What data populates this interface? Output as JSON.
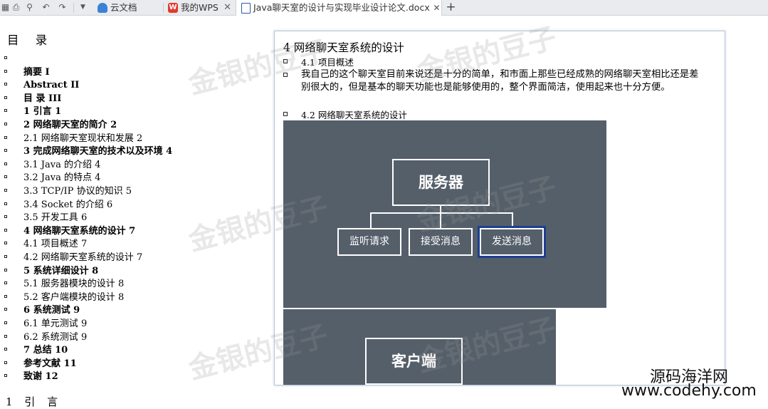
{
  "tabs": [
    {
      "label": "云文档",
      "icon": "cloud-doc-icon",
      "color": "#3b82d6"
    },
    {
      "label": "我的WPS",
      "icon": "wps-logo-icon",
      "color": "#e23a2e"
    },
    {
      "label": "Java聊天室的设计与实现毕业设计论文.docx",
      "icon": "word-doc-icon",
      "color": "#2c5aa0",
      "active": true
    }
  ],
  "toc": {
    "title": "目 录",
    "items": [
      {
        "text": "",
        "bold": false
      },
      {
        "text": "摘要    I",
        "bold": true
      },
      {
        "text": "Abstract    II",
        "bold": true
      },
      {
        "text": "目  录    III",
        "bold": true
      },
      {
        "text": "1 引言    1",
        "bold": true
      },
      {
        "text": "2 网络聊天室的简介    2",
        "bold": true
      },
      {
        "text": "2.1 网络聊天室现状和发展    2",
        "bold": false
      },
      {
        "text": "3 完成网络聊天室的技术以及环境    4",
        "bold": true
      },
      {
        "text": "3.1 Java 的介绍    4",
        "bold": false
      },
      {
        "text": "3.2 Java 的特点    4",
        "bold": false
      },
      {
        "text": "3.3 TCP/IP 协议的知识    5",
        "bold": false
      },
      {
        "text": "3.4 Socket 的介绍    6",
        "bold": false
      },
      {
        "text": "3.5 开发工具    6",
        "bold": false
      },
      {
        "text": "4 网络聊天室系统的设计    7",
        "bold": true
      },
      {
        "text": "4.1 项目概述    7",
        "bold": false
      },
      {
        "text": "4.2 网络聊天室系统的设计    7",
        "bold": false
      },
      {
        "text": "5 系统详细设计    8",
        "bold": true
      },
      {
        "text": "5.1 服务器模块的设计    8",
        "bold": false
      },
      {
        "text": "5.2 客户端模块的设计    8",
        "bold": false
      },
      {
        "text": "6 系统测试    9",
        "bold": true
      },
      {
        "text": "6.1 单元测试    9",
        "bold": false
      },
      {
        "text": "6.2 系统测试    9",
        "bold": false
      },
      {
        "text": "7 总结    10",
        "bold": true
      },
      {
        "text": "参考文献    11",
        "bold": true
      },
      {
        "text": "致谢    12",
        "bold": true
      }
    ],
    "bottom_heading": "1 引 言"
  },
  "document": {
    "chapter": "4 网络聊天室系统的设计",
    "section1": "4.1 项目概述",
    "paragraph": "我自己的这个聊天室目前来说还是十分的简单，和市面上那些已经成熟的网络聊天室相比还是差别很大的，但是基本的聊天功能也是能够使用的，整个界面简洁，使用起来也十分方便。",
    "section2": "4.2 网络聊天室系统的设计",
    "diagram": {
      "server": "服务器",
      "children": [
        "监听请求",
        "接受消息",
        "发送消息"
      ],
      "client": "客户端",
      "bg_color": "#555f6a",
      "selected_border": "#1e3f8f"
    }
  },
  "watermark": "金银的豆子",
  "site_watermark": {
    "line1": "源码海洋网",
    "line2": "www.codehy.com"
  }
}
